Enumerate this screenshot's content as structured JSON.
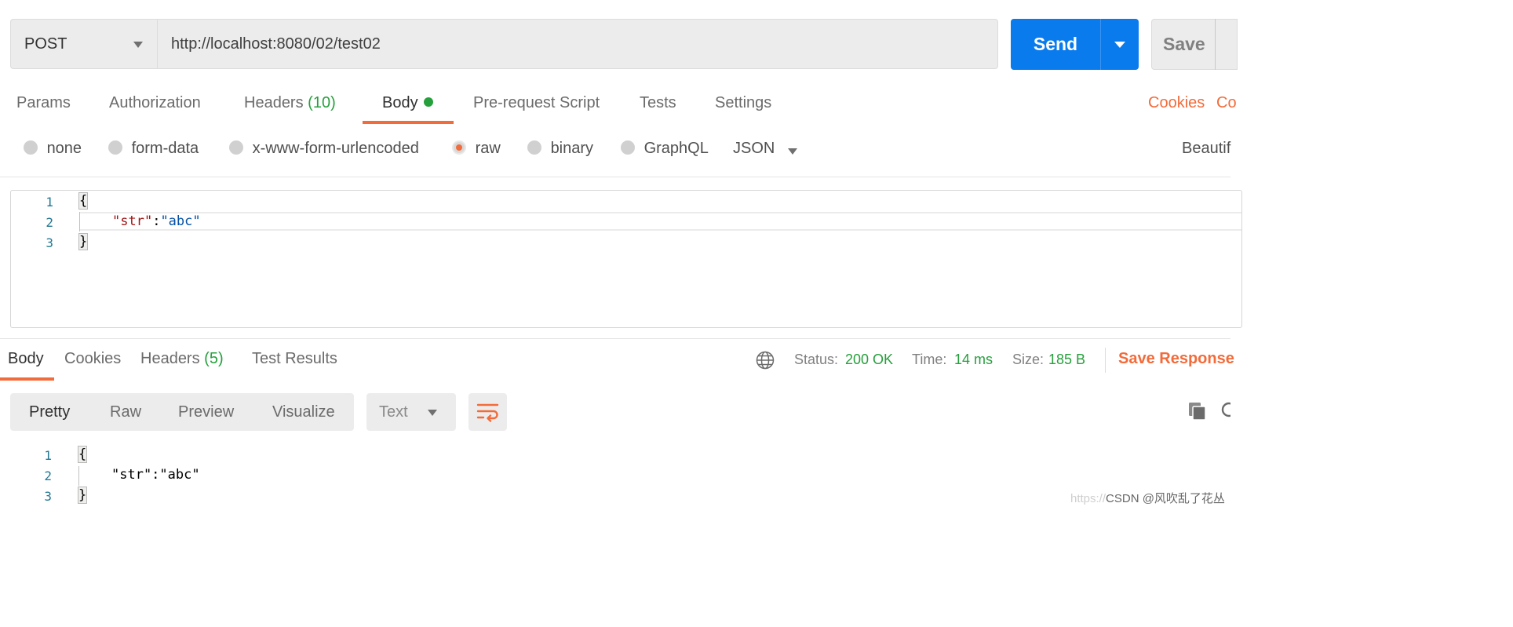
{
  "request": {
    "method": "POST",
    "url": "http://localhost:8080/02/test02",
    "send_label": "Send",
    "save_label": "Save"
  },
  "request_tabs": {
    "params": "Params",
    "authorization": "Authorization",
    "headers": "Headers",
    "headers_count": "(10)",
    "body": "Body",
    "prerequest": "Pre-request Script",
    "tests": "Tests",
    "settings": "Settings",
    "cookies": "Cookies",
    "code_partial": "Co"
  },
  "body_types": {
    "none": "none",
    "form_data": "form-data",
    "urlencoded": "x-www-form-urlencoded",
    "raw": "raw",
    "binary": "binary",
    "graphql": "GraphQL",
    "format": "JSON",
    "beautify_partial": "Beautif",
    "selected": "raw"
  },
  "request_editor": {
    "lines": [
      {
        "num": "1",
        "text": "{"
      },
      {
        "num": "2",
        "key": "\"str\"",
        "colon": ":",
        "value": "\"abc\""
      },
      {
        "num": "3",
        "text": "}"
      }
    ]
  },
  "response_tabs": {
    "body": "Body",
    "cookies": "Cookies",
    "headers": "Headers",
    "headers_count": "(5)",
    "test_results": "Test Results"
  },
  "response_status": {
    "status_label": "Status:",
    "status_value": "200 OK",
    "time_label": "Time:",
    "time_value": "14 ms",
    "size_label": "Size:",
    "size_value": "185 B",
    "save_response": "Save Response"
  },
  "response_view": {
    "pretty": "Pretty",
    "raw": "Raw",
    "preview": "Preview",
    "visualize": "Visualize",
    "format": "Text"
  },
  "response_body": {
    "lines": [
      {
        "num": "1",
        "text": "{"
      },
      {
        "num": "2",
        "text": "\"str\":\"abc\""
      },
      {
        "num": "3",
        "text": "}"
      }
    ]
  },
  "watermark": {
    "faded": "https://",
    "text": "CSDN @风吹乱了花丛"
  },
  "colors": {
    "accent": "#f26b3a",
    "send_blue": "#097bed",
    "success_green": "#26a03c"
  }
}
